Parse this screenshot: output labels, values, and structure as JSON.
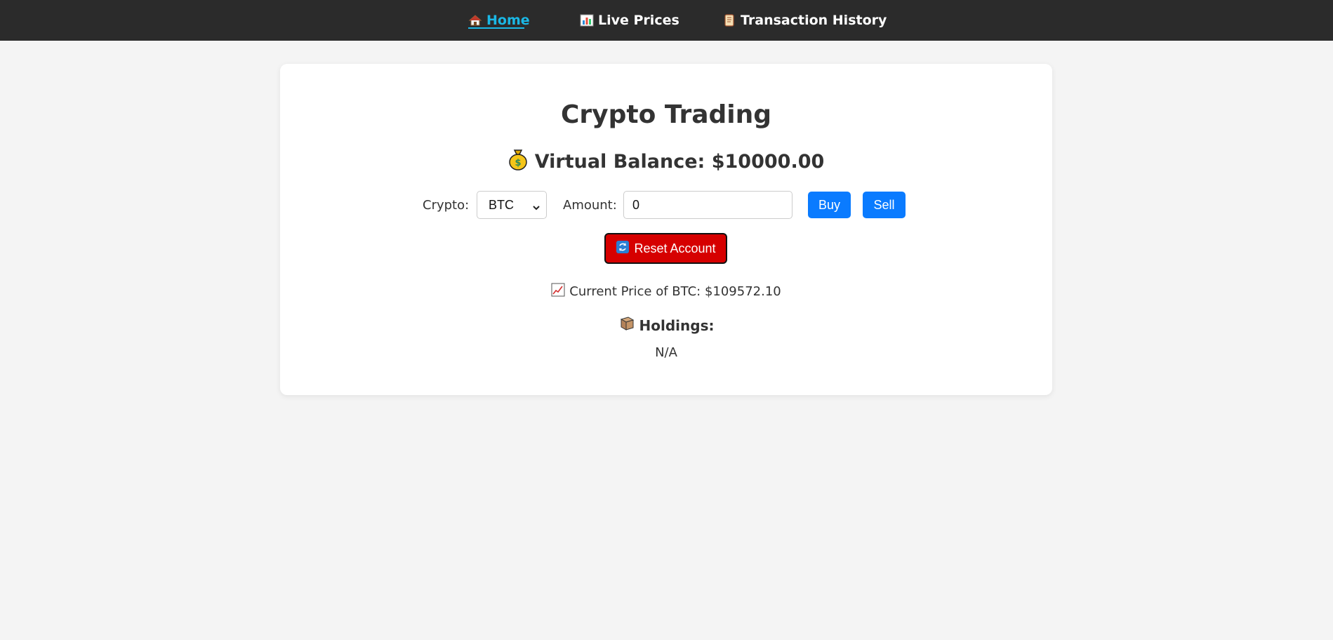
{
  "nav": {
    "items": [
      {
        "label": "Home",
        "icon": "house-icon",
        "active": true
      },
      {
        "label": "Live Prices",
        "icon": "bar-chart-icon",
        "active": false
      },
      {
        "label": "Transaction History",
        "icon": "scroll-icon",
        "active": false
      }
    ]
  },
  "main": {
    "title": "Crypto Trading",
    "balance_label": "Virtual Balance: $10000.00",
    "crypto_label": "Crypto:",
    "crypto_selected": "BTC",
    "amount_label": "Amount:",
    "amount_value": "0",
    "buy_label": "Buy",
    "sell_label": "Sell",
    "reset_label": "Reset Account",
    "current_price": "Current Price of BTC: $109572.10",
    "holdings_label": "Holdings:",
    "holdings_value": "N/A"
  },
  "colors": {
    "navbar_bg": "#2b2b2b",
    "active_link": "#1ab8e6",
    "button_blue": "#0a7bff",
    "button_red": "#d60000",
    "page_bg": "#f4f4f4"
  }
}
